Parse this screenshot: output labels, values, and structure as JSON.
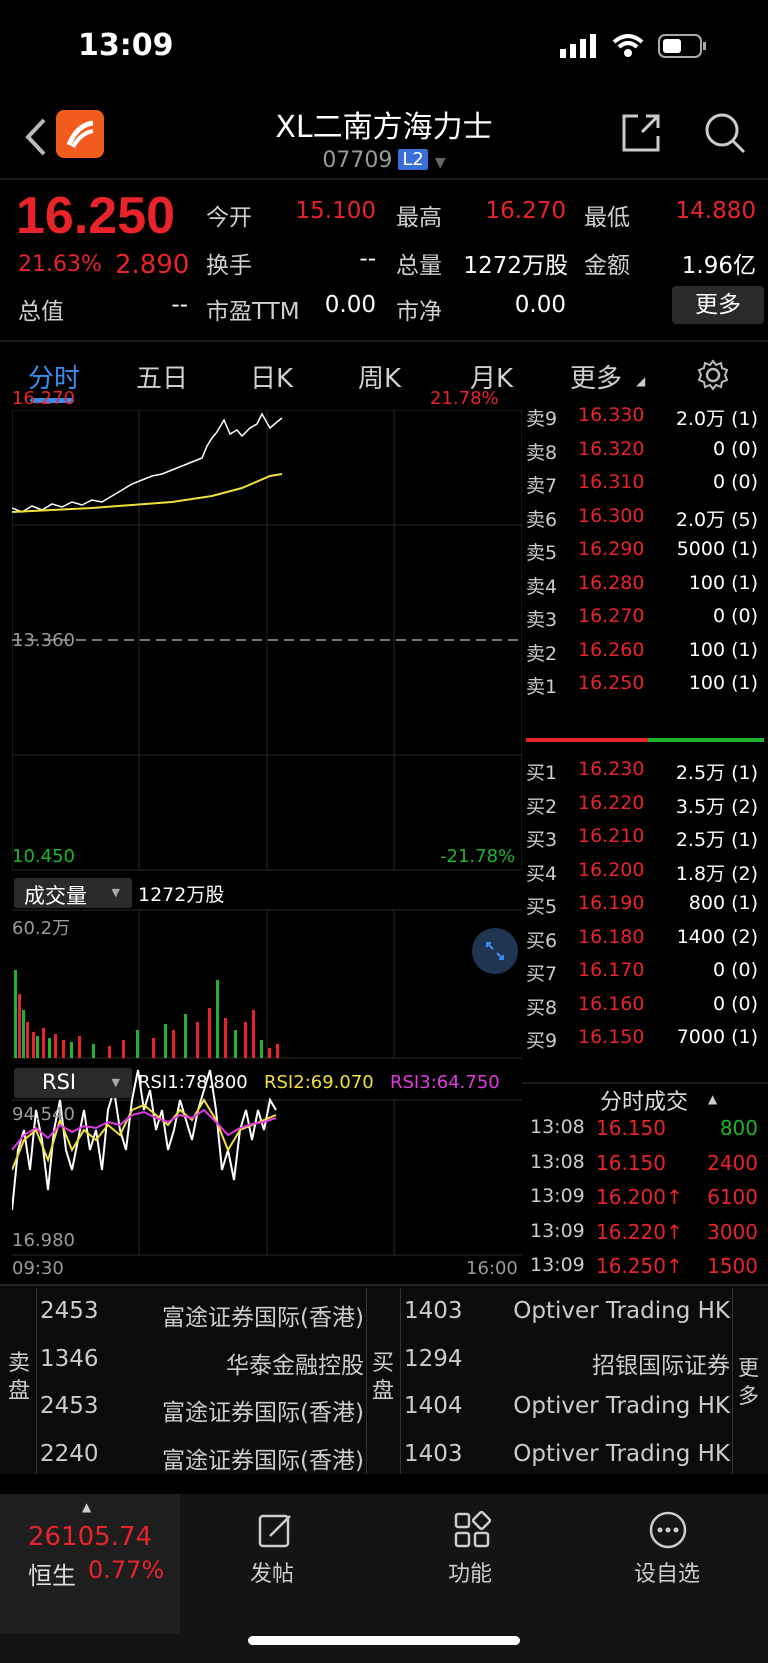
{
  "status": {
    "time": "13:09"
  },
  "header": {
    "title": "XL二南方海力士",
    "code": "07709",
    "badge": "L2"
  },
  "quote": {
    "price": "16.250",
    "change_pct": "21.63%",
    "change": "2.890",
    "rows": [
      [
        {
          "label": "今开",
          "value": "15.100",
          "color": "red"
        },
        {
          "label": "最高",
          "value": "16.270",
          "color": "red"
        },
        {
          "label": "最低",
          "value": "14.880",
          "color": "red"
        }
      ],
      [
        {
          "label": "换手",
          "value": "--",
          "color": "white"
        },
        {
          "label": "总量",
          "value": "1272万股",
          "color": "white"
        },
        {
          "label": "金额",
          "value": "1.96亿",
          "color": "white"
        }
      ],
      [
        {
          "label": "市盈TTM",
          "value": "0.00",
          "color": "white"
        },
        {
          "label": "市净",
          "value": "0.00",
          "color": "white"
        }
      ]
    ],
    "total_value_label": "总值",
    "total_value": "--",
    "more": "更多"
  },
  "tabs": [
    "分时",
    "五日",
    "日K",
    "周K",
    "月K",
    "更多"
  ],
  "chart": {
    "top_price": "16.270",
    "top_pct": "21.78%",
    "mid_price": "13.360",
    "bottom_price": "10.450",
    "bottom_pct": "-21.78%",
    "volume_label": "成交量",
    "volume_total": "1272万股",
    "volume_max": "60.2万",
    "rsi_label": "RSI",
    "rsi1": "RSI1:78.800",
    "rsi2": "RSI2:69.070",
    "rsi3": "RSI3:64.750",
    "rsi_top": "94.540",
    "rsi_bottom": "16.980",
    "time_start": "09:30",
    "time_end": "16:00",
    "colors": {
      "price_line": "#ffffff",
      "avg_line": "#f0e03a",
      "rsi3": "#e23ae2"
    }
  },
  "orderbook": {
    "asks": [
      {
        "label": "卖9",
        "price": "16.330",
        "qty": "2.0万 (1)"
      },
      {
        "label": "卖8",
        "price": "16.320",
        "qty": "0 (0)"
      },
      {
        "label": "卖7",
        "price": "16.310",
        "qty": "0 (0)"
      },
      {
        "label": "卖6",
        "price": "16.300",
        "qty": "2.0万 (5)"
      },
      {
        "label": "卖5",
        "price": "16.290",
        "qty": "5000 (1)"
      },
      {
        "label": "卖4",
        "price": "16.280",
        "qty": "100 (1)"
      },
      {
        "label": "卖3",
        "price": "16.270",
        "qty": "0 (0)"
      },
      {
        "label": "卖2",
        "price": "16.260",
        "qty": "100 (1)"
      },
      {
        "label": "卖1",
        "price": "16.250",
        "qty": "100 (1)"
      }
    ],
    "bids": [
      {
        "label": "买1",
        "price": "16.230",
        "qty": "2.5万 (1)"
      },
      {
        "label": "买2",
        "price": "16.220",
        "qty": "3.5万 (2)"
      },
      {
        "label": "买3",
        "price": "16.210",
        "qty": "2.5万 (1)"
      },
      {
        "label": "买4",
        "price": "16.200",
        "qty": "1.8万 (2)"
      },
      {
        "label": "买5",
        "price": "16.190",
        "qty": "800 (1)"
      },
      {
        "label": "买6",
        "price": "16.180",
        "qty": "1400 (2)"
      },
      {
        "label": "买7",
        "price": "16.170",
        "qty": "0 (0)"
      },
      {
        "label": "买8",
        "price": "16.160",
        "qty": "0 (0)"
      },
      {
        "label": "买9",
        "price": "16.150",
        "qty": "7000 (1)"
      }
    ]
  },
  "ticks": {
    "title": "分时成交",
    "rows": [
      {
        "time": "13:08",
        "price": "16.150",
        "qty": "800",
        "qty_color": "green"
      },
      {
        "time": "13:08",
        "price": "16.150",
        "qty": "2400",
        "qty_color": "red"
      },
      {
        "time": "13:09",
        "price": "16.200↑",
        "qty": "6100",
        "qty_color": "red"
      },
      {
        "time": "13:09",
        "price": "16.220↑",
        "qty": "3000",
        "qty_color": "red"
      },
      {
        "time": "13:09",
        "price": "16.250↑",
        "qty": "1500",
        "qty_color": "red"
      }
    ]
  },
  "brokers": {
    "sell_label": "卖盘",
    "buy_label": "买盘",
    "more_label": "更多",
    "sell": [
      {
        "id": "2453",
        "name": "富途证券国际(香港)"
      },
      {
        "id": "1346",
        "name": "华泰金融控股"
      },
      {
        "id": "2453",
        "name": "富途证券国际(香港)"
      },
      {
        "id": "2240",
        "name": "富途证券国际(香港)"
      }
    ],
    "buy": [
      {
        "id": "1403",
        "name": "Optiver Trading HK"
      },
      {
        "id": "1294",
        "name": "招银国际证券"
      },
      {
        "id": "1404",
        "name": "Optiver Trading HK"
      },
      {
        "id": "1403",
        "name": "Optiver Trading HK"
      }
    ]
  },
  "bottom": {
    "index_value": "26105.74",
    "index_name": "恒生",
    "index_pct": "0.77%",
    "post": "发帖",
    "functions": "功能",
    "watchlist": "设自选"
  }
}
